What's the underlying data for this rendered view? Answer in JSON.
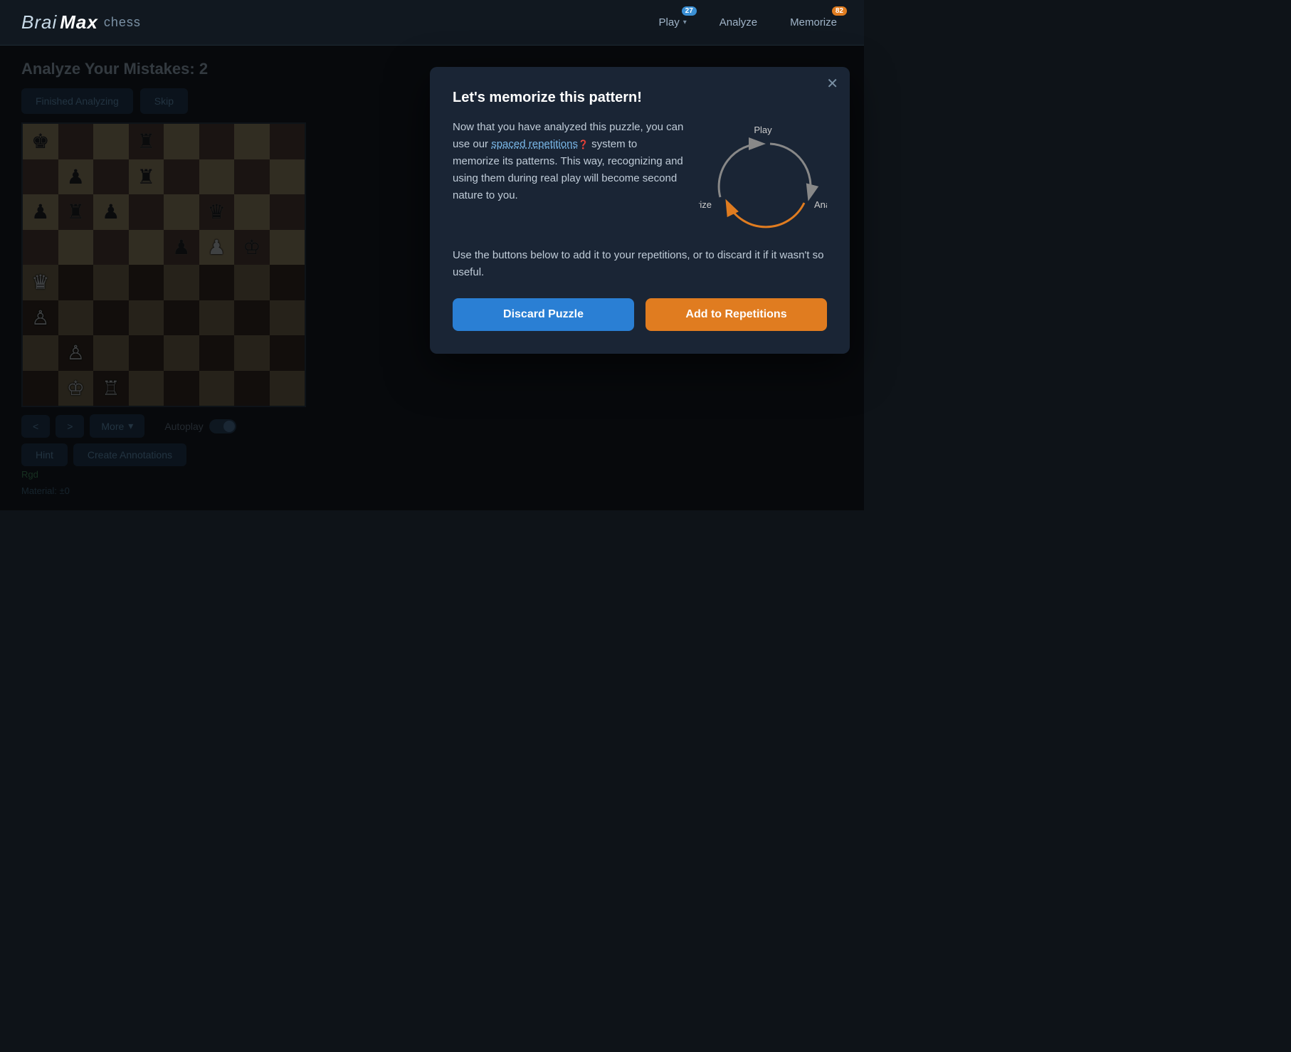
{
  "header": {
    "logo": {
      "brai": "Brai",
      "max": "Max",
      "chess": "chess"
    },
    "nav": {
      "play_label": "Play",
      "analyze_label": "Analyze",
      "memorize_label": "Memorize",
      "play_badge": "27",
      "memorize_badge": "82"
    }
  },
  "page": {
    "title": "Analyze Your Mistakes: 2"
  },
  "buttons": {
    "finished_analyzing": "Finished Analyzing",
    "skip": "Skip",
    "prev": "<",
    "next": ">",
    "more": "More",
    "autoplay": "Autoplay",
    "hint": "Hint",
    "create_annotations": "Create Annotations"
  },
  "material": "Material: ±0",
  "pgn": "Rgd",
  "modal": {
    "title": "Let's memorize this pattern!",
    "body1_start": "Now that you have analyzed this puzzle, you can use our ",
    "spaced_rep": "spaced repetitions",
    "body1_end": " system to memorize its patterns. This way, recognizing and using them during real play will become second nature to you.",
    "body2": "Use the buttons below to add it to your repetitions, or to discard it if it wasn't so useful.",
    "discard_btn": "Discard Puzzle",
    "add_btn": "Add to Repetitions",
    "cycle": {
      "play": "Play",
      "analyze": "Analyze",
      "memorize": "Memorize"
    }
  },
  "board": {
    "pieces": [
      {
        "rank": 0,
        "file": 0,
        "piece": "♚",
        "color": "black"
      },
      {
        "rank": 0,
        "file": 3,
        "piece": "♜",
        "color": "black"
      },
      {
        "rank": 1,
        "file": 1,
        "piece": "♟",
        "color": "black"
      },
      {
        "rank": 1,
        "file": 3,
        "piece": "♜",
        "color": "black"
      },
      {
        "rank": 2,
        "file": 0,
        "piece": "♟",
        "color": "black"
      },
      {
        "rank": 2,
        "file": 1,
        "piece": "♜",
        "color": "black"
      },
      {
        "rank": 2,
        "file": 2,
        "piece": "♟",
        "color": "black"
      },
      {
        "rank": 2,
        "file": 5,
        "piece": "♛",
        "color": "black"
      },
      {
        "rank": 3,
        "file": 4,
        "piece": "♟",
        "color": "black"
      },
      {
        "rank": 3,
        "file": 5,
        "piece": "♟",
        "color": "white"
      },
      {
        "rank": 3,
        "file": 6,
        "piece": "♔",
        "color": "black"
      },
      {
        "rank": 4,
        "file": 0,
        "piece": "♛",
        "color": "white"
      },
      {
        "rank": 5,
        "file": 0,
        "piece": "♙",
        "color": "white"
      },
      {
        "rank": 6,
        "file": 1,
        "piece": "♙",
        "color": "white"
      },
      {
        "rank": 7,
        "file": 1,
        "piece": "♔",
        "color": "white"
      },
      {
        "rank": 7,
        "file": 2,
        "piece": "♖",
        "color": "white"
      }
    ]
  }
}
